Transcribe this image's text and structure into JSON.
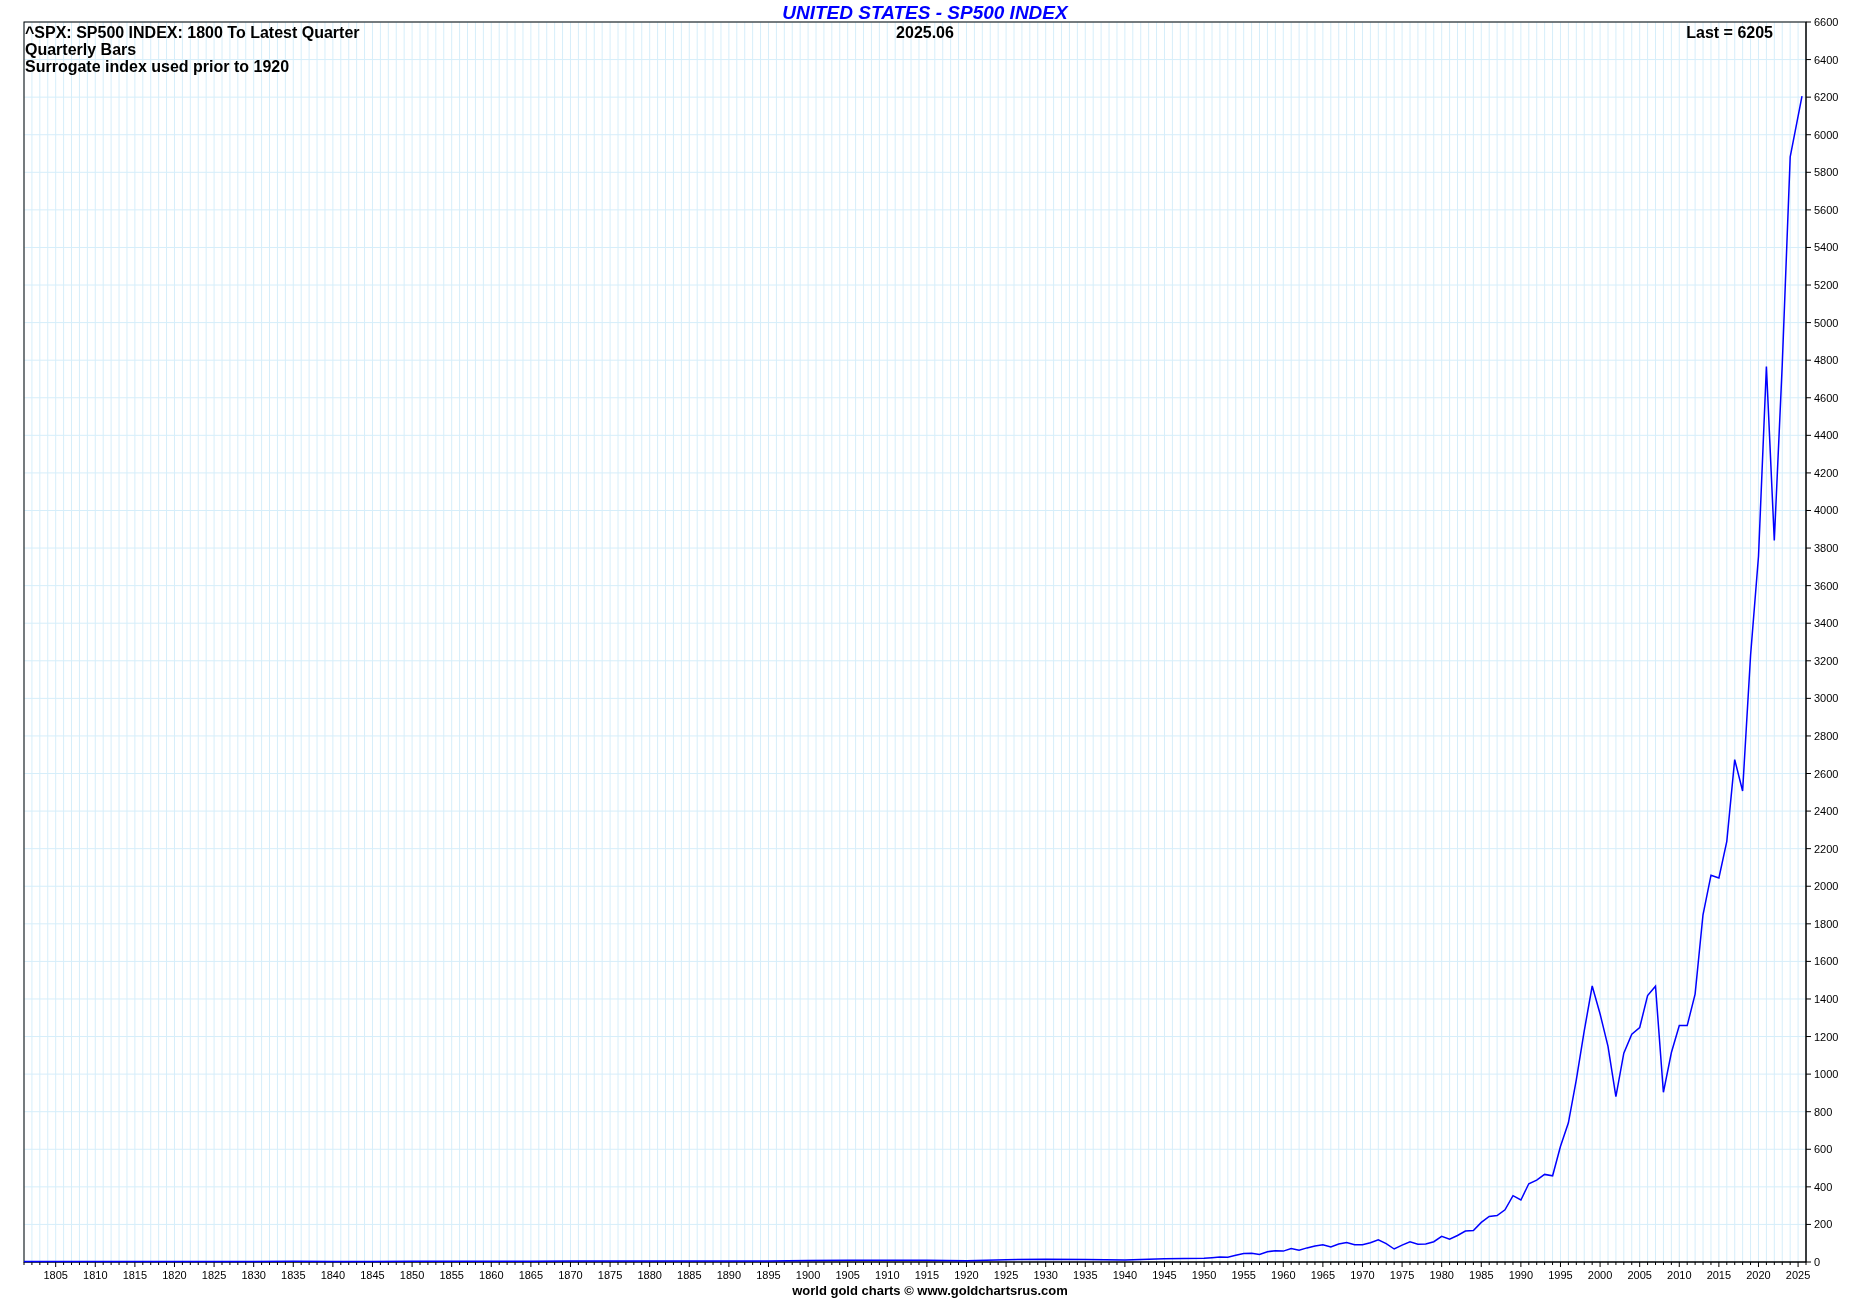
{
  "title": "UNITED STATES - SP500 INDEX",
  "notes": [
    "^SPX: SP500 INDEX: 1800 To Latest Quarter",
    "Quarterly Bars",
    "Surrogate index used prior to 1920"
  ],
  "date": "2025.06",
  "last": "Last = 6205",
  "footer": "world gold charts © www.goldchartsrus.com",
  "chart_data": {
    "type": "line",
    "grid": true,
    "xlim": [
      1801,
      2026
    ],
    "ylim": [
      0,
      6600
    ],
    "xticks": [
      1805,
      1810,
      1815,
      1820,
      1825,
      1830,
      1835,
      1840,
      1845,
      1850,
      1855,
      1860,
      1865,
      1870,
      1875,
      1880,
      1885,
      1890,
      1895,
      1900,
      1905,
      1910,
      1915,
      1920,
      1925,
      1930,
      1935,
      1940,
      1945,
      1950,
      1955,
      1960,
      1965,
      1970,
      1975,
      1980,
      1985,
      1990,
      1995,
      2000,
      2005,
      2010,
      2015,
      2020,
      2025
    ],
    "yticks": [
      0,
      200,
      400,
      600,
      800,
      1000,
      1200,
      1400,
      1600,
      1800,
      2000,
      2200,
      2400,
      2600,
      2800,
      3000,
      3200,
      3400,
      3600,
      3800,
      4000,
      4200,
      4400,
      4600,
      4800,
      5000,
      5200,
      5400,
      5600,
      5800,
      6000,
      6200,
      6400,
      6600
    ],
    "x": [
      1801,
      1805,
      1810,
      1815,
      1820,
      1825,
      1830,
      1835,
      1840,
      1845,
      1850,
      1855,
      1860,
      1865,
      1870,
      1875,
      1880,
      1885,
      1890,
      1895,
      1900,
      1905,
      1910,
      1915,
      1920,
      1925,
      1930,
      1935,
      1940,
      1945,
      1950,
      1951,
      1952,
      1953,
      1954,
      1955,
      1956,
      1957,
      1958,
      1959,
      1960,
      1961,
      1962,
      1963,
      1964,
      1965,
      1966,
      1967,
      1968,
      1969,
      1970,
      1971,
      1972,
      1973,
      1974,
      1975,
      1976,
      1977,
      1978,
      1979,
      1980,
      1981,
      1982,
      1983,
      1984,
      1985,
      1986,
      1987,
      1988,
      1989,
      1990,
      1991,
      1992,
      1993,
      1994,
      1995,
      1996,
      1997,
      1998,
      1999,
      2000,
      2001,
      2002,
      2003,
      2004,
      2005,
      2006,
      2007,
      2008,
      2009,
      2010,
      2011,
      2012,
      2013,
      2014,
      2015,
      2016,
      2017,
      2018,
      2019,
      2020,
      2021,
      2022,
      2023,
      2024,
      2025.5
    ],
    "series": [
      {
        "color": "#0000ff",
        "values": [
          3,
          3,
          3,
          3,
          3,
          3,
          3,
          4,
          3,
          3,
          4,
          4,
          4,
          4,
          5,
          5,
          6,
          6,
          6,
          6,
          8,
          9,
          9,
          9,
          7,
          12,
          15,
          13,
          11,
          17,
          20,
          23,
          26,
          25,
          36,
          45,
          47,
          40,
          55,
          60,
          58,
          72,
          63,
          75,
          85,
          92,
          80,
          96,
          104,
          92,
          92,
          102,
          118,
          98,
          69,
          90,
          107,
          95,
          96,
          108,
          136,
          122,
          141,
          165,
          167,
          211,
          242,
          247,
          278,
          353,
          330,
          417,
          436,
          466,
          459,
          616,
          741,
          970,
          1229,
          1469,
          1320,
          1148,
          880,
          1112,
          1212,
          1248,
          1418,
          1468,
          903,
          1115,
          1258,
          1258,
          1426,
          1848,
          2059,
          2044,
          2239,
          2674,
          2507,
          3231,
          3756,
          4766,
          3840,
          4770,
          5882,
          6205
        ]
      }
    ]
  }
}
